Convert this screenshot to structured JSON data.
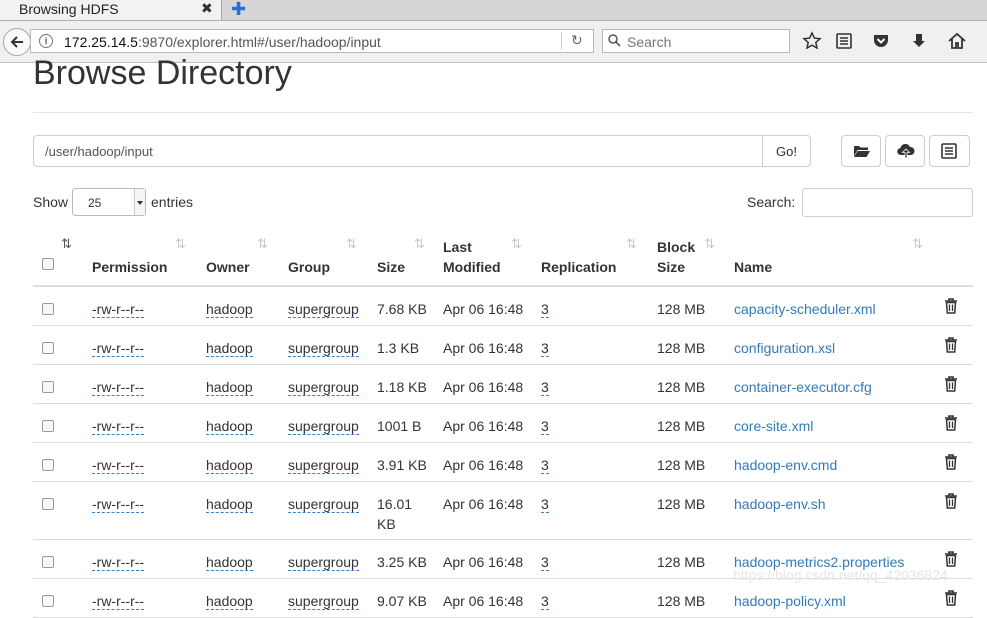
{
  "browser": {
    "tab_title": "Browsing HDFS",
    "url_host": "172.25.14.5",
    "url_rest": ":9870/explorer.html#/user/hadoop/input",
    "search_placeholder": "Search"
  },
  "page": {
    "title": "Browse Directory",
    "path_value": "/user/hadoop/input",
    "go_label": "Go!",
    "show_label": "Show",
    "entries_value": "25",
    "entries_label": "entries",
    "search_label": "Search:"
  },
  "table": {
    "headers": {
      "permission": "Permission",
      "owner": "Owner",
      "group": "Group",
      "size": "Size",
      "last_modified_1": "Last",
      "last_modified_2": "Modified",
      "replication": "Replication",
      "block_size_1": "Block",
      "block_size_2": "Size",
      "name": "Name"
    },
    "rows": [
      {
        "permission": "-rw-r--r--",
        "owner": "hadoop",
        "group": "supergroup",
        "size": "7.68 KB",
        "size2": "",
        "modified": "Apr 06 16:48",
        "replication": "3",
        "block_size": "128 MB",
        "name": "capacity-scheduler.xml"
      },
      {
        "permission": "-rw-r--r--",
        "owner": "hadoop",
        "group": "supergroup",
        "size": "1.3 KB",
        "size2": "",
        "modified": "Apr 06 16:48",
        "replication": "3",
        "block_size": "128 MB",
        "name": "configuration.xsl"
      },
      {
        "permission": "-rw-r--r--",
        "owner": "hadoop",
        "group": "supergroup",
        "size": "1.18 KB",
        "size2": "",
        "modified": "Apr 06 16:48",
        "replication": "3",
        "block_size": "128 MB",
        "name": "container-executor.cfg"
      },
      {
        "permission": "-rw-r--r--",
        "owner": "hadoop",
        "group": "supergroup",
        "size": "1001 B",
        "size2": "",
        "modified": "Apr 06 16:48",
        "replication": "3",
        "block_size": "128 MB",
        "name": "core-site.xml"
      },
      {
        "permission": "-rw-r--r--",
        "owner": "hadoop",
        "group": "supergroup",
        "size": "3.91 KB",
        "size2": "",
        "modified": "Apr 06 16:48",
        "replication": "3",
        "block_size": "128 MB",
        "name": "hadoop-env.cmd"
      },
      {
        "permission": "-rw-r--r--",
        "owner": "hadoop",
        "group": "supergroup",
        "size": "16.01",
        "size2": "KB",
        "modified": "Apr 06 16:48",
        "replication": "3",
        "block_size": "128 MB",
        "name": "hadoop-env.sh"
      },
      {
        "permission": "-rw-r--r--",
        "owner": "hadoop",
        "group": "supergroup",
        "size": "3.25 KB",
        "size2": "",
        "modified": "Apr 06 16:48",
        "replication": "3",
        "block_size": "128 MB",
        "name": "hadoop-metrics2.properties"
      },
      {
        "permission": "-rw-r--r--",
        "owner": "hadoop",
        "group": "supergroup",
        "size": "9.07 KB",
        "size2": "",
        "modified": "Apr 06 16:48",
        "replication": "3",
        "block_size": "128 MB",
        "name": "hadoop-policy.xml"
      }
    ]
  },
  "watermark": "https://blog.csdn.net/qq_42036824"
}
